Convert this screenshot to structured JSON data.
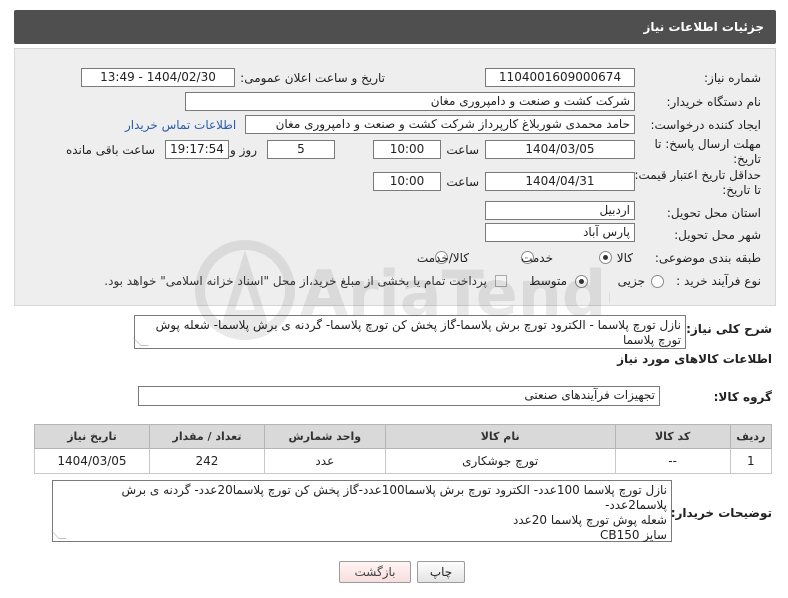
{
  "header": {
    "title": "جزئیات اطلاعات نیاز"
  },
  "fields": {
    "need_number_label": "شماره نیاز:",
    "need_number": "1104001609000674",
    "announce_label": "تاریخ و ساعت اعلان عمومی:",
    "announce_value": "1404/02/30 - 13:49",
    "buyer_org_label": "نام دستگاه خریدار:",
    "buyer_org": "شرکت کشت و صنعت و دامپروری مغان",
    "creator_label": "ایجاد کننده درخواست:",
    "creator": "حامد محمدی شوربلاغ کارپرداز شرکت کشت و صنعت و دامپروری مغان",
    "contact_link": "اطلاعات تماس خریدار",
    "deadline_label_1": "مهلت ارسال پاسخ: تا",
    "deadline_label_2": "تاریخ:",
    "deadline_date": "1404/03/05",
    "time_label": "ساعت",
    "deadline_time": "10:00",
    "days_value": "5",
    "days_label": "روز و",
    "remaining_time": "19:17:54",
    "remaining_label": "ساعت باقی مانده",
    "validity_label_1": "حداقل تاریخ اعتبار قیمت:",
    "validity_label_2": "تا تاریخ:",
    "validity_date": "1404/04/31",
    "validity_time_label": "ساعت",
    "validity_time": "10:00",
    "province_label": "استان محل تحویل:",
    "province": "اردبیل",
    "city_label": "شهر محل تحویل:",
    "city": "پارس آباد",
    "category_label": "طبقه بندی موضوعی:",
    "category_options": [
      "کالا",
      "خدمت",
      "کالا/خدمت"
    ],
    "category_selected": "کالا",
    "process_label": "نوع فرآیند خرید :",
    "process_options": [
      "جزیی",
      "متوسط"
    ],
    "process_selected": "متوسط",
    "process_note": "پرداخت تمام یا بخشی از مبلغ خرید،از محل \"اسناد خزانه اسلامی\" خواهد بود."
  },
  "summary": {
    "label": "شرح کلی نیاز:",
    "text": "نازل تورچ پلاسما - الکترود تورچ برش پلاسما-گاز پخش کن تورچ پلاسما- گردنه ی برش پلاسما- شعله پوش تورچ پلاسما"
  },
  "goods": {
    "section_title": "اطلاعات کالاهای مورد نیاز",
    "group_label": "گروه کالا:",
    "group_value": "تجهیزات فرآیندهای صنعتی",
    "columns": [
      "ردیف",
      "کد کالا",
      "نام کالا",
      "واحد شمارش",
      "تعداد / مقدار",
      "تاریخ نیاز"
    ],
    "rows": [
      {
        "row": "1",
        "code": "--",
        "name": "تورچ جوشکاری",
        "unit": "عدد",
        "qty": "242",
        "date": "1404/03/05"
      }
    ]
  },
  "buyer_notes": {
    "label": "توضیحات خریدار:",
    "lines": [
      "نازل تورچ پلاسما 100عدد- الکترود تورچ برش پلاسما100عدد-گاز پخش کن تورچ پلاسما20عدد- گردنه ی برش پلاسما2عدد-",
      "شعله پوش تورچ پلاسما 20عدد",
      "سایز CB150"
    ]
  },
  "buttons": {
    "print": "چاپ",
    "back": "بازگشت"
  },
  "watermark": {
    "brand": "AriaTender.net"
  },
  "colors": {
    "header_bg": "#4f4f4f",
    "form_bg": "#eeeeee",
    "link": "#2a5db0",
    "back_btn": "#f8dede"
  }
}
